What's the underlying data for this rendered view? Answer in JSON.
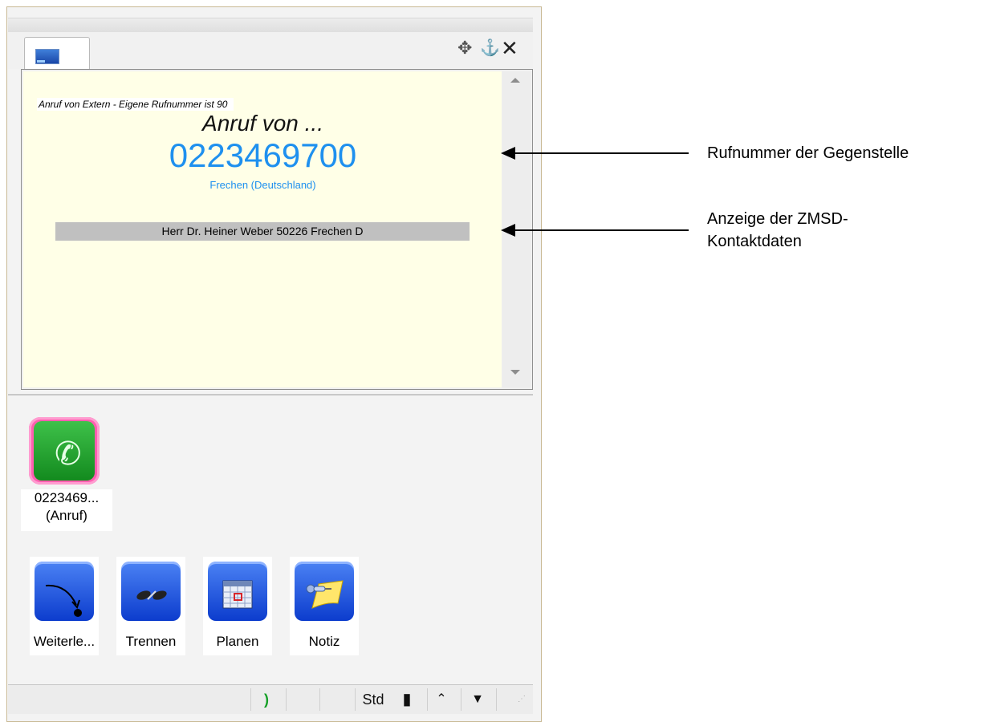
{
  "window": {
    "tab_title": "",
    "title_buttons": {
      "move_icon": "move-icon",
      "pin_icon": "pin-icon",
      "close_icon": "close-icon"
    }
  },
  "call_info": {
    "info_line": "Anruf von Extern - Eigene Rufnummer ist 90",
    "call_from": "Anruf von ...",
    "number": "0223469700",
    "location": "Frechen (Deutschland)",
    "contact": "Herr Dr. Heiner Weber 50226 Frechen D"
  },
  "call_button": {
    "icon": "phone-handset-icon",
    "label_line1": "0223469...",
    "label_line2": "(Anruf)"
  },
  "actions": [
    {
      "label": "Weiterle...",
      "icon": "forward-arrow-icon"
    },
    {
      "label": "Trennen",
      "icon": "disconnect-icon"
    },
    {
      "label": "Planen",
      "icon": "calendar-icon"
    },
    {
      "label": "Notiz",
      "icon": "note-pin-icon"
    }
  ],
  "statusbar": {
    "std_label": "Std",
    "phone_icon": "phone-handset-icon",
    "mobile_icon": "mobile-phone-icon",
    "expand_icon": "double-chevron-up-icon",
    "dropdown_icon": "triangle-down-icon"
  },
  "annotations": {
    "number_label": "Rufnummer der Gegenstelle",
    "contact_label_line1": "Anzeige der ZMSD-",
    "contact_label_line2": "Kontaktdaten"
  },
  "colors": {
    "accent": "#1e90ef",
    "panel_bg": "#ffffe7",
    "contact_bg": "#c0c0c0"
  }
}
